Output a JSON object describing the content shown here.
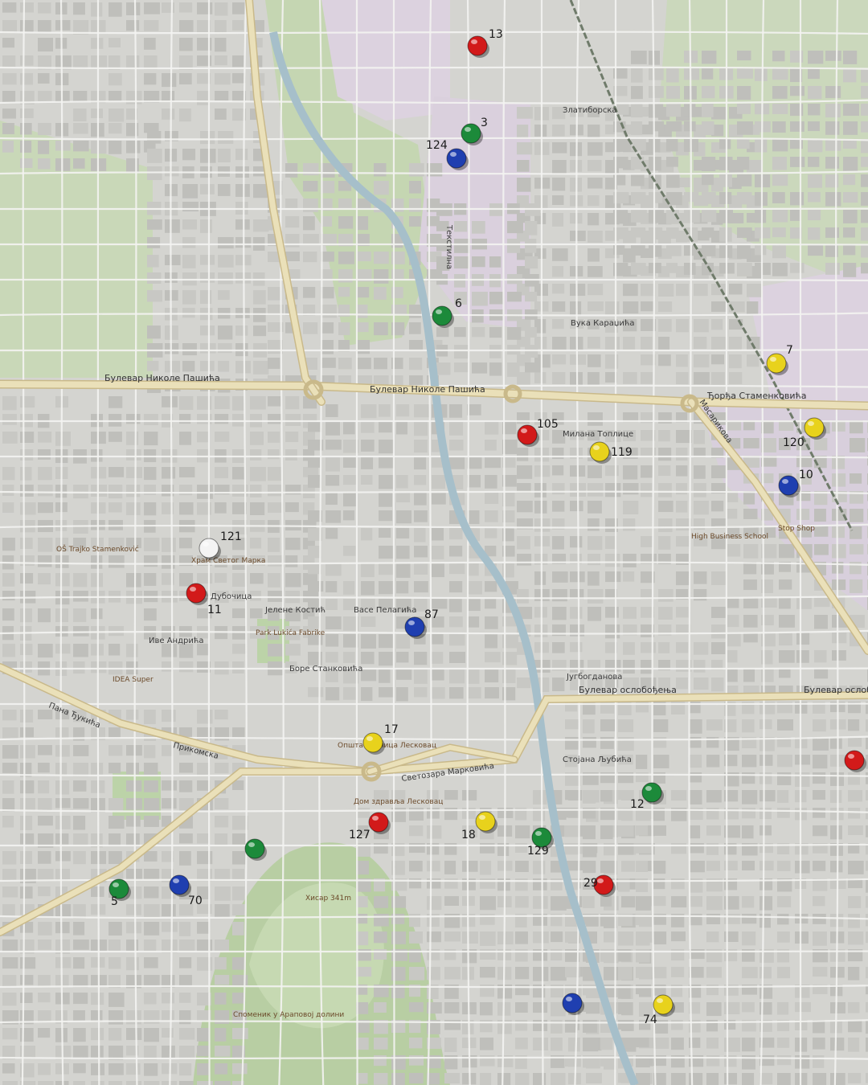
{
  "colors": {
    "background": "#d8d8d4",
    "block": "#c9c9c5",
    "minor_street": "#f5f5f3",
    "major_road": "#e9dfb8",
    "major_road_edge": "#c9b98a",
    "green": "#c7d8b6",
    "park": "#b9cfa5",
    "industrial": "#d9cfdc",
    "river": "#9fb8c4",
    "railway": "#7f8a78"
  },
  "roads": {
    "bulevar_nikole_pasica": "Булевар Николе Пашића",
    "bulevar_oslobodjenja": "Булевар ослобођења",
    "djordja_stamenkovica": "Ђорђа Стаменковића",
    "svetozara_markovica": "Светозара Марковића",
    "stojana_ljubica": "Стојана Љубића",
    "pana_djukica": "Пана Ђукића",
    "dubocica": "Дубочица",
    "tekstilna": "Текстилна",
    "zlatiborska": "Златиборска",
    "vuka_karadzica": "Вука Караџића",
    "milana_toplice": "Милана Топлице",
    "masarikova": "Масарикова",
    "jugbogdanova": "Југбогданова",
    "bora_stankovica": "Боре Станковића",
    "vasa_pelagica": "Васе Пелагића",
    "jelene_kostic": "Јелене Костић",
    "ive_andrica": "Иве Андрића",
    "prikomska": "Прикомска"
  },
  "pois": {
    "church": "Храм Светог Марка",
    "hisar": "Хисар 341m",
    "monument": "Споменик у Араповој долини",
    "dom_zdravlja": "Дом здравља Лесковац",
    "opstina": "Општа болница Лесковац",
    "high_business_school": "High Business School",
    "idea_super": "IDEA Super",
    "park_lukic": "Park Lukića Fabrike",
    "stop_shop": "Stop Shop",
    "school": "OŠ Trajko Stamenković"
  },
  "pins": [
    {
      "id": "13",
      "label": "13",
      "color": "red"
    },
    {
      "id": "3",
      "label": "3",
      "color": "green"
    },
    {
      "id": "124",
      "label": "124",
      "color": "blue"
    },
    {
      "id": "6",
      "label": "6",
      "color": "green"
    },
    {
      "id": "7",
      "label": "7",
      "color": "yellow"
    },
    {
      "id": "105",
      "label": "105",
      "color": "red"
    },
    {
      "id": "119",
      "label": "119",
      "color": "yellow"
    },
    {
      "id": "120",
      "label": "120",
      "color": "yellow"
    },
    {
      "id": "10",
      "label": "10",
      "color": "blue"
    },
    {
      "id": "121",
      "label": "121",
      "color": "white"
    },
    {
      "id": "11",
      "label": "11",
      "color": "red"
    },
    {
      "id": "87",
      "label": "87",
      "color": "blue"
    },
    {
      "id": "17",
      "label": "17",
      "color": "yellow"
    },
    {
      "id": "127",
      "label": "127",
      "color": "red"
    },
    {
      "id": "18",
      "label": "18",
      "color": "yellow"
    },
    {
      "id": "129",
      "label": "129",
      "color": "green"
    },
    {
      "id": "12",
      "label": "12",
      "color": "green"
    },
    {
      "id": "29",
      "label": "29",
      "color": "red"
    },
    {
      "id": "5",
      "label": "5",
      "color": "green"
    },
    {
      "id": "70",
      "label": "70",
      "color": "blue"
    },
    {
      "id": "74",
      "label": "74",
      "color": "yellow"
    },
    {
      "id": "unl-1",
      "label": "",
      "color": "green"
    },
    {
      "id": "unl-2",
      "label": "",
      "color": "blue"
    },
    {
      "id": "unl-3",
      "label": "",
      "color": "red"
    }
  ],
  "pin_colors": {
    "red": "#d21a1a",
    "green": "#1c8a3a",
    "blue": "#1f3fb0",
    "yellow": "#e8d21c",
    "white": "#f4f4f4"
  }
}
